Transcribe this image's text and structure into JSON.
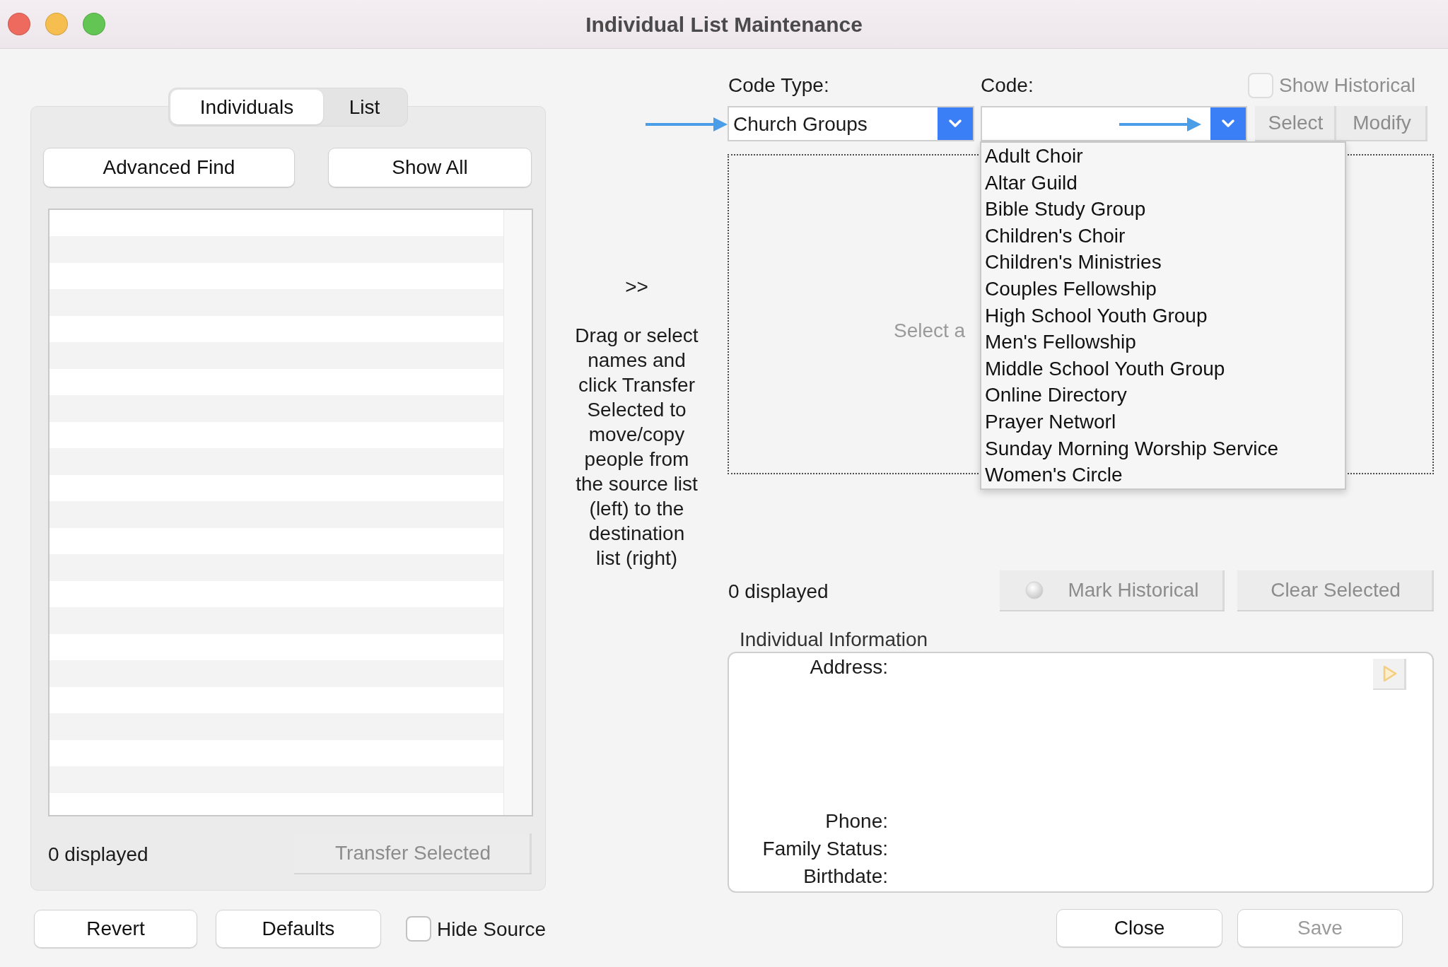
{
  "window": {
    "title": "Individual List Maintenance"
  },
  "source_panel": {
    "tabs": [
      {
        "label": "Individuals",
        "selected": true
      },
      {
        "label": "List",
        "selected": false
      }
    ],
    "buttons": [
      {
        "label": "Advanced Find",
        "disabled": false
      },
      {
        "label": "Show All",
        "disabled": false
      }
    ],
    "count": "0 displayed",
    "transfer_button": {
      "label": "Transfer Selected",
      "disabled": true
    }
  },
  "transfer_hint": {
    "symbol": ">>",
    "text": "Drag or select names and click Transfer Selected to move/copy people from the source list (left) to the destination list (right)"
  },
  "destination_panel": {
    "code_type": {
      "label": "Code Type:",
      "value": "Church Groups"
    },
    "code": {
      "label": "Code:",
      "expanded": true,
      "options": [
        {
          "label": "Adult Choir",
          "selected": false
        },
        {
          "label": "Altar Guild",
          "selected": false
        },
        {
          "label": "Bible Study Group",
          "selected": false
        },
        {
          "label": "Children's Choir",
          "selected": false
        },
        {
          "label": "Children's Ministries",
          "selected": false
        },
        {
          "label": "Couples Fellowship",
          "selected": false
        },
        {
          "label": "High School Youth Group",
          "selected": false
        },
        {
          "label": "Men's Fellowship",
          "selected": false
        },
        {
          "label": "Middle School Youth Group",
          "selected": false
        },
        {
          "label": "Online Directory",
          "selected": false
        },
        {
          "label": "Prayer Networl",
          "selected": false
        },
        {
          "label": "Sunday Morning Worship Service",
          "selected": false
        },
        {
          "label": "Women's Circle",
          "selected": false
        }
      ]
    },
    "show_historical": {
      "label": "Show Historical",
      "checked": false,
      "disabled": true
    },
    "buttons": [
      {
        "label": "Select",
        "disabled": true
      },
      {
        "label": "Modify",
        "disabled": true
      }
    ],
    "list_message": "Select a",
    "count": "0 displayed",
    "actions": [
      {
        "kind": "indicator",
        "label": "Mark Historical",
        "disabled": true
      },
      {
        "kind": "plain",
        "label": "Clear Selected",
        "disabled": true
      }
    ]
  },
  "individual_information": {
    "title": "Individual Information",
    "fields": [
      {
        "kind": "multiline",
        "label": "Address:"
      },
      {
        "kind": "single",
        "label": "Phone:"
      },
      {
        "kind": "single",
        "label": "Family Status:"
      },
      {
        "kind": "single",
        "label": "Birthdate:"
      }
    ],
    "next_button": {
      "disabled": true
    }
  },
  "footer": {
    "left_buttons": [
      {
        "label": "Revert",
        "disabled": false
      },
      {
        "label": "Defaults",
        "disabled": false
      }
    ],
    "hide_source": {
      "label": "Hide Source",
      "checked": false
    },
    "right_buttons": [
      {
        "label": "Close",
        "disabled": false
      },
      {
        "label": "Save",
        "disabled": true
      }
    ]
  }
}
